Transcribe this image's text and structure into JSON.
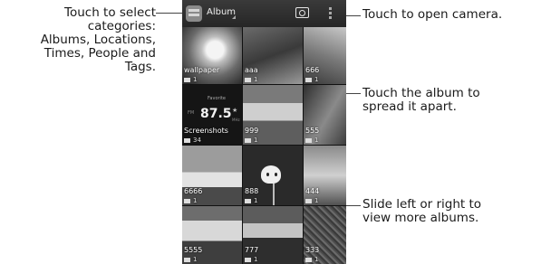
{
  "annotations": {
    "left": {
      "lines": [
        "Touch to select",
        "categories:",
        "Albums, Locations,",
        "Times, People and",
        "Tags."
      ]
    },
    "camera": {
      "lines": [
        "Touch to open camera."
      ]
    },
    "album": {
      "lines": [
        "Touch the album to",
        "spread it apart."
      ]
    },
    "slide": {
      "lines": [
        "Slide left or right to",
        "view more albums."
      ]
    }
  },
  "app": {
    "title": "Album",
    "icons": {
      "app": "gallery-app-icon",
      "camera": "camera-icon",
      "menu": "overflow-menu-icon"
    }
  },
  "radio_widget": {
    "label": "Favorite",
    "band": "FM",
    "frequency": "87.5",
    "unit": "MHz"
  },
  "albums": [
    {
      "name": "wallpaper",
      "count": "1"
    },
    {
      "name": "aaa",
      "count": "1"
    },
    {
      "name": "666",
      "count": "1"
    },
    {
      "name": "Screenshots",
      "count": "34"
    },
    {
      "name": "999",
      "count": "1"
    },
    {
      "name": "555",
      "count": "1"
    },
    {
      "name": "6666",
      "count": "1"
    },
    {
      "name": "888",
      "count": "1"
    },
    {
      "name": "444",
      "count": "1"
    },
    {
      "name": "5555",
      "count": "1"
    },
    {
      "name": "777",
      "count": "1"
    },
    {
      "name": "333",
      "count": "1"
    }
  ]
}
